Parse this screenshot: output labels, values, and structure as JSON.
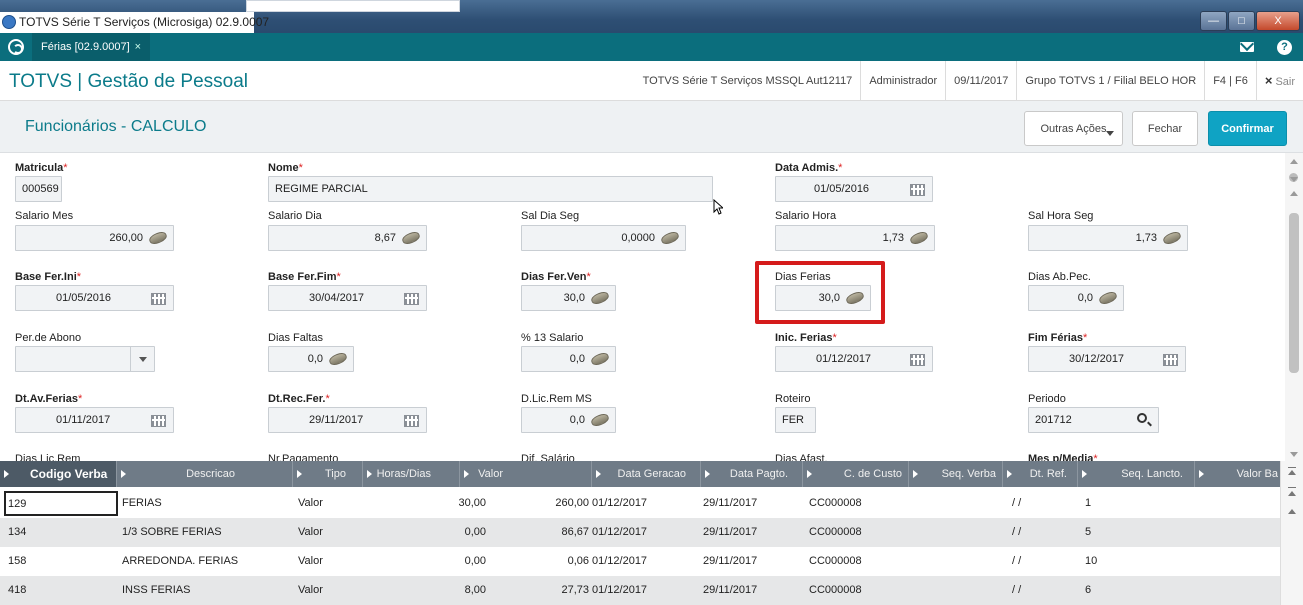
{
  "window": {
    "title": "TOTVS Série T Serviços (Microsiga) 02.9.0007",
    "minimize_label": "—",
    "maximize_label": "□",
    "close_label": "X"
  },
  "tabbar": {
    "tab_label": "Férias [02.9.0007]",
    "tab_close": "×",
    "help_label": "?"
  },
  "header": {
    "app_title": "TOTVS | Gestão de Pessoal",
    "environment": "TOTVS Série T Serviços MSSQL Aut12117",
    "user": "Administrador",
    "date": "09/11/2017",
    "group": "Grupo TOTVS 1 / Filial BELO HOR",
    "shortcuts": "F4 | F6",
    "exit_icon": "×",
    "exit_label": "Sair"
  },
  "formbar": {
    "title": "Funcionários - CALCULO",
    "other_actions": "Outras Ações",
    "close": "Fechar",
    "confirm": "Confirmar"
  },
  "fields": {
    "matricula": {
      "label": "Matricula",
      "value": "000569",
      "required": true
    },
    "nome": {
      "label": "Nome",
      "value": "REGIME PARCIAL",
      "required": true
    },
    "data_admis": {
      "label": "Data Admis.",
      "value": "01/05/2016",
      "required": true
    },
    "salario_mes": {
      "label": "Salario Mes",
      "value": "260,00"
    },
    "salario_dia": {
      "label": "Salario Dia",
      "value": "8,67"
    },
    "sal_dia_seg": {
      "label": "Sal Dia Seg",
      "value": "0,0000"
    },
    "salario_hora": {
      "label": "Salario Hora",
      "value": "1,73"
    },
    "sal_hora_seg": {
      "label": "Sal Hora Seg",
      "value": "1,73"
    },
    "base_fer_ini": {
      "label": "Base Fer.Ini",
      "value": "01/05/2016",
      "required": true
    },
    "base_fer_fim": {
      "label": "Base Fer.Fim",
      "value": "30/04/2017",
      "required": true
    },
    "dias_fer_ven": {
      "label": "Dias Fer.Ven",
      "value": "30,0",
      "required": true
    },
    "dias_ferias": {
      "label": "Dias Ferias",
      "value": "30,0"
    },
    "dias_ab_pec": {
      "label": "Dias Ab.Pec.",
      "value": "0,0"
    },
    "per_abono": {
      "label": "Per.de Abono",
      "value": ""
    },
    "dias_faltas": {
      "label": "Dias Faltas",
      "value": "0,0"
    },
    "pct_13_salario": {
      "label": "% 13 Salario",
      "value": "0,0"
    },
    "inic_ferias": {
      "label": "Inic. Ferias",
      "value": "01/12/2017",
      "required": true
    },
    "fim_ferias": {
      "label": "Fim Férias",
      "value": "30/12/2017",
      "required": true
    },
    "dt_av_ferias": {
      "label": "Dt.Av.Ferias",
      "value": "01/11/2017",
      "required": true
    },
    "dt_rec_fer": {
      "label": "Dt.Rec.Fer.",
      "value": "29/11/2017",
      "required": true
    },
    "d_lic_rem_ms": {
      "label": "D.Lic.Rem MS",
      "value": "0,0"
    },
    "roteiro": {
      "label": "Roteiro",
      "value": "FER"
    },
    "periodo": {
      "label": "Periodo",
      "value": "201712"
    },
    "dias_lic_rem": {
      "label": "Dias Lic.Rem"
    },
    "nr_pagamento": {
      "label": "Nr.Pagamento"
    },
    "dif_salario": {
      "label": "Dif. Salário"
    },
    "dias_afast": {
      "label": "Dias Afast."
    },
    "mes_p_media": {
      "label": "Mes p/Media",
      "required": true
    },
    "asterisk": "*"
  },
  "grid": {
    "columns": [
      "Codigo Verba",
      "Descricao",
      "Tipo",
      "Horas/Dias",
      "Valor",
      "Data Geracao",
      "Data Pagto.",
      "C. de Custo",
      "Seq. Verba",
      "Dt. Ref.",
      "Seq. Lancto.",
      "Valor Ba"
    ],
    "rows": [
      {
        "codigo": "129",
        "descricao": "FERIAS",
        "tipo": "Valor",
        "horas": "30,00",
        "valor": "260,00",
        "data_geracao": "01/12/2017",
        "data_pagto": "29/11/2017",
        "c_custo": "CC000008",
        "seq_verba": "",
        "dt_ref": "/ /",
        "seq_lancto": "1"
      },
      {
        "codigo": "134",
        "descricao": "1/3 SOBRE FERIAS",
        "tipo": "Valor",
        "horas": "0,00",
        "valor": "86,67",
        "data_geracao": "01/12/2017",
        "data_pagto": "29/11/2017",
        "c_custo": "CC000008",
        "seq_verba": "",
        "dt_ref": "/ /",
        "seq_lancto": "5"
      },
      {
        "codigo": "158",
        "descricao": "ARREDONDA. FERIAS",
        "tipo": "Valor",
        "horas": "0,00",
        "valor": "0,06",
        "data_geracao": "01/12/2017",
        "data_pagto": "29/11/2017",
        "c_custo": "CC000008",
        "seq_verba": "",
        "dt_ref": "/ /",
        "seq_lancto": "10"
      },
      {
        "codigo": "418",
        "descricao": "INSS FERIAS",
        "tipo": "Valor",
        "horas": "8,00",
        "valor": "27,73",
        "data_geracao": "01/12/2017",
        "data_pagto": "29/11/2017",
        "c_custo": "CC000008",
        "seq_verba": "",
        "dt_ref": "/ /",
        "seq_lancto": "6"
      }
    ]
  },
  "colors": {
    "tabbar": "#0b6e7d",
    "accent": "#0b7b8a",
    "confirm": "#0fa3c4",
    "highlight": "#d51b1b",
    "grid_header": "#6f7b87"
  }
}
